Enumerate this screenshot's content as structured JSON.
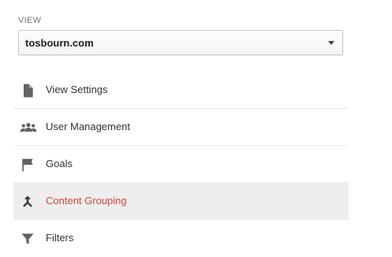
{
  "view": {
    "label": "VIEW",
    "selected_value": "tosbourn.com"
  },
  "menu": {
    "items": [
      {
        "label": "View Settings",
        "icon": "document-icon",
        "selected": false
      },
      {
        "label": "User Management",
        "icon": "people-icon",
        "selected": false
      },
      {
        "label": "Goals",
        "icon": "flag-icon",
        "selected": false
      },
      {
        "label": "Content Grouping",
        "icon": "merge-icon",
        "selected": true
      },
      {
        "label": "Filters",
        "icon": "filter-icon",
        "selected": false
      }
    ]
  },
  "colors": {
    "selected_text": "#d0453a",
    "selected_background": "#eeeeee",
    "icon": "#616161"
  }
}
